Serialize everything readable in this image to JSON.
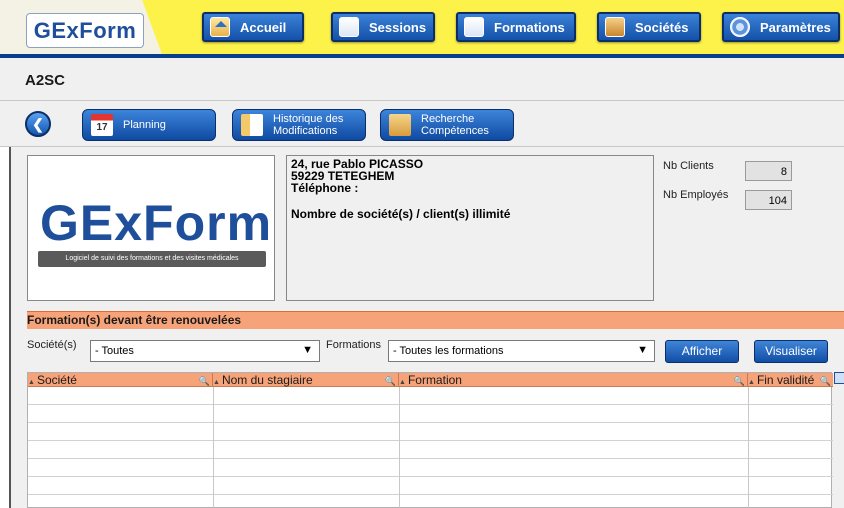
{
  "app": {
    "logo": "GExForm",
    "nav": [
      {
        "label": "Accueil",
        "icon": "home-icon"
      },
      {
        "label": "Sessions",
        "icon": "document-icon"
      },
      {
        "label": "Formations",
        "icon": "clipboard-icon"
      },
      {
        "label": "Sociétés",
        "icon": "people-icon"
      },
      {
        "label": "Paramètres",
        "icon": "gear-icon"
      }
    ]
  },
  "page": {
    "title": "A2SC"
  },
  "subnav": {
    "back_icon": "back-arrow-icon",
    "planning": {
      "label": "Planning",
      "icon_text": "17"
    },
    "history": {
      "line1": "Historique des",
      "line2": "Modifications"
    },
    "skills": {
      "line1": "Recherche",
      "line2": "Compétences"
    }
  },
  "company": {
    "logo_text": "GExForm",
    "logo_tagline": "Logiciel de suivi des formations et des visites médicales",
    "address_line1": "24, rue Pablo PICASSO",
    "address_line2": "59229 TETEGHEM",
    "phone_label": "Téléphone :",
    "license": "Nombre de société(s) / client(s) illimité",
    "nb_clients_label": "Nb Clients",
    "nb_clients": "8",
    "nb_employes_label": "Nb Employés",
    "nb_employes": "104"
  },
  "renewals": {
    "header": "Formation(s) devant être renouvelées",
    "societe_label": "Société(s)",
    "societe_value": "- Toutes",
    "formations_label": "Formations",
    "formations_value": "- Toutes les formations",
    "afficher_label": "Afficher",
    "visualiser_label": "Visualiser",
    "columns": [
      "Société",
      "Nom du stagiaire",
      "Formation",
      "Fin validité"
    ]
  },
  "colors": {
    "brand_blue": "#1f4f9b",
    "nav_yellow": "#fdf24a",
    "section_orange": "#f7a37a"
  }
}
